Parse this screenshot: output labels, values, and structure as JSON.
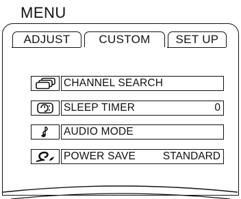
{
  "title": "MENU",
  "tabs": [
    {
      "label": "ADJUST",
      "selected": false
    },
    {
      "label": "CUSTOM",
      "selected": true
    },
    {
      "label": "SET UP",
      "selected": false
    }
  ],
  "items": [
    {
      "label": "CHANNEL SEARCH",
      "value": "",
      "icon": "stacked-screens-icon"
    },
    {
      "label": "SLEEP TIMER",
      "value": "0",
      "icon": "clock-timer-icon"
    },
    {
      "label": "AUDIO MODE",
      "value": "",
      "icon": "music-note-icon"
    },
    {
      "label": "POWER SAVE",
      "value": "STANDARD",
      "icon": "leaf-power-icon"
    }
  ]
}
